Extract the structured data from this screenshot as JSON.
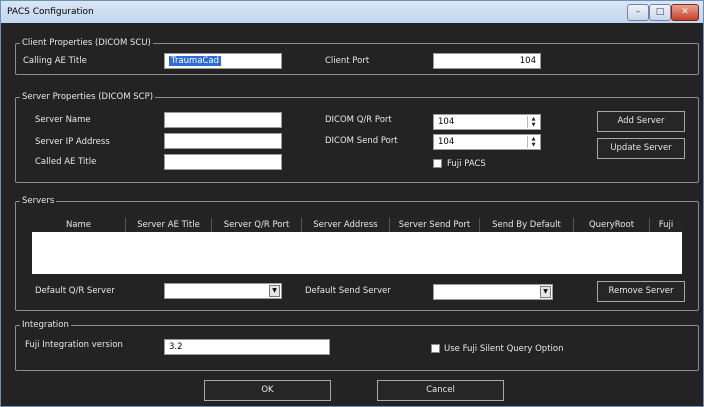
{
  "window": {
    "title": "PACS Configuration"
  },
  "client": {
    "legend": "Client Properties (DICOM SCU)",
    "calling_ae_label": "Calling AE Title",
    "calling_ae_value": "TraumaCad",
    "client_port_label": "Client Port",
    "client_port_value": "104"
  },
  "server": {
    "legend": "Server Properties (DICOM SCP)",
    "name_label": "Server Name",
    "name_value": "",
    "ip_label": "Server IP Address",
    "ip_value": "",
    "called_ae_label": "Called AE Title",
    "called_ae_value": "",
    "qr_port_label": "DICOM Q/R Port",
    "qr_port_value": "104",
    "send_port_label": "DICOM Send Port",
    "send_port_value": "104",
    "fuji_pacs_label": "Fuji PACS",
    "add_button": "Add Server",
    "update_button": "Update Server"
  },
  "servers": {
    "legend": "Servers",
    "columns": [
      "Name",
      "Server AE Title",
      "Server Q/R Port",
      "Server Address",
      "Server Send Port",
      "Send By Default",
      "QueryRoot",
      "Fuji"
    ],
    "rows": [],
    "default_qr_label": "Default Q/R Server",
    "default_qr_value": "",
    "default_send_label": "Default Send Server",
    "default_send_value": "",
    "remove_button": "Remove Server"
  },
  "integration": {
    "legend": "Integration",
    "version_label": "Fuji Integration version",
    "version_value": "3.2",
    "silent_query_label": "Use Fuji Silent Query Option"
  },
  "footer": {
    "ok_label": "OK",
    "cancel_label": "Cancel"
  }
}
